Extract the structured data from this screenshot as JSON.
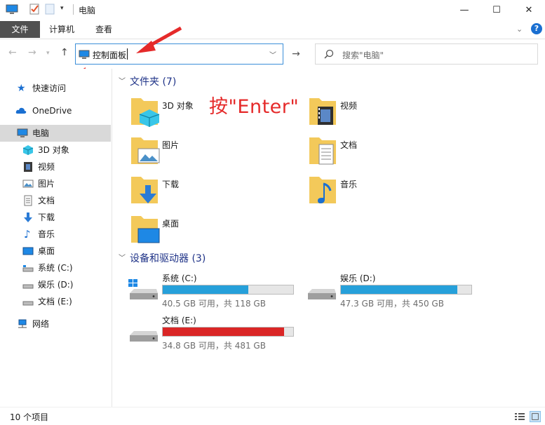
{
  "window": {
    "title": "电脑",
    "controls": {
      "minimize": "—",
      "maximize": "☐",
      "close": "✕"
    }
  },
  "ribbon": {
    "tabs": [
      "文件",
      "计算机",
      "查看"
    ],
    "collapse_icon": "chevron-down-icon",
    "help_icon": "?"
  },
  "address_bar": {
    "value": "控制面板",
    "go_icon": "→"
  },
  "search": {
    "placeholder": "搜索\"电脑\""
  },
  "sidebar": {
    "items": [
      {
        "label": "快速访问",
        "icon": "star-icon"
      },
      {
        "label": "OneDrive",
        "icon": "cloud-icon"
      },
      {
        "label": "电脑",
        "icon": "computer-icon",
        "selected": true
      },
      {
        "label": "3D 对象",
        "icon": "cube-icon"
      },
      {
        "label": "视频",
        "icon": "film-icon"
      },
      {
        "label": "图片",
        "icon": "picture-icon"
      },
      {
        "label": "文档",
        "icon": "document-icon"
      },
      {
        "label": "下载",
        "icon": "download-icon"
      },
      {
        "label": "音乐",
        "icon": "music-icon"
      },
      {
        "label": "桌面",
        "icon": "desktop-icon"
      },
      {
        "label": "系统 (C:)",
        "icon": "drive-icon"
      },
      {
        "label": "娱乐 (D:)",
        "icon": "drive-icon"
      },
      {
        "label": "文档 (E:)",
        "icon": "drive-icon"
      },
      {
        "label": "网络",
        "icon": "network-icon"
      }
    ]
  },
  "folders_group": {
    "header": "文件夹 (7)",
    "items": [
      {
        "label": "3D 对象",
        "icon": "cube-folder-icon"
      },
      {
        "label": "视频",
        "icon": "video-folder-icon"
      },
      {
        "label": "图片",
        "icon": "picture-folder-icon"
      },
      {
        "label": "文档",
        "icon": "document-folder-icon"
      },
      {
        "label": "下载",
        "icon": "download-folder-icon"
      },
      {
        "label": "音乐",
        "icon": "music-folder-icon"
      },
      {
        "label": "桌面",
        "icon": "desktop-folder-icon"
      }
    ]
  },
  "drives_group": {
    "header": "设备和驱动器 (3)",
    "items": [
      {
        "name": "系统 (C:)",
        "info": "40.5 GB 可用，共 118 GB",
        "used_fraction": 0.657,
        "color": "#26a0da"
      },
      {
        "name": "娱乐 (D:)",
        "info": "47.3 GB 可用，共 450 GB",
        "used_fraction": 0.895,
        "color": "#26a0da"
      },
      {
        "name": "文档 (E:)",
        "info": "34.8 GB 可用，共 481 GB",
        "used_fraction": 0.928,
        "color": "#da2626"
      }
    ]
  },
  "annotation": "按\"Enter\"",
  "status": {
    "item_count": "10 个项目"
  },
  "colors": {
    "accent": "#1a6fd1",
    "group_header": "#1e3287",
    "annotation_red": "#e52a2a",
    "bar_blue": "#26a0da",
    "bar_red": "#da2626"
  }
}
